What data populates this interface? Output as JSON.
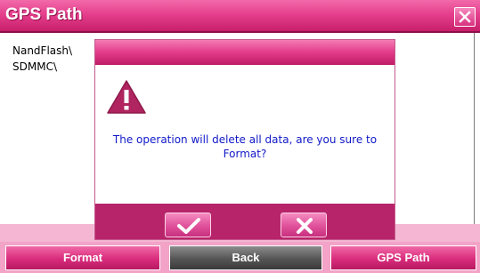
{
  "window": {
    "title": "GPS Path"
  },
  "paths": [
    {
      "label": "NandFlash\\"
    },
    {
      "label": "SDMMC\\"
    }
  ],
  "dialog": {
    "message_line1": "The operation will delete all data, are you sure to",
    "message_line2": "Format?"
  },
  "toolbar": {
    "format_label": "Format",
    "back_label": "Back",
    "gps_path_label": "GPS Path"
  },
  "colors": {
    "accent": "#e23b89",
    "message_text": "#1018c8"
  },
  "icons": {
    "close": "close-icon",
    "warning": "warning-icon",
    "confirm": "checkmark-icon",
    "cancel": "cross-icon"
  }
}
